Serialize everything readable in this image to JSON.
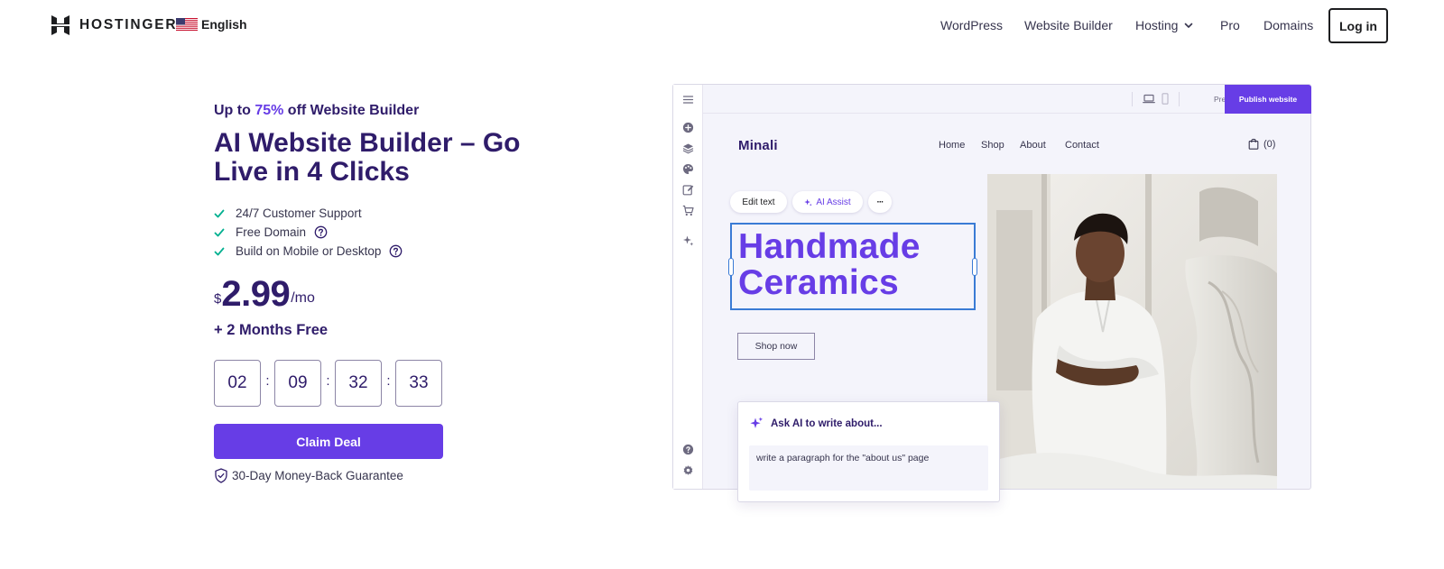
{
  "header": {
    "brand": "HOSTINGER",
    "language": "English",
    "nav": [
      {
        "label": "WordPress"
      },
      {
        "label": "Website Builder"
      },
      {
        "label": "Hosting"
      },
      {
        "label": "Pro"
      },
      {
        "label": "Domains"
      }
    ],
    "login_label": "Log in",
    "icons": {
      "logo": "hostinger-logo-icon",
      "flag": "us-flag-icon",
      "dropdown": "chevron-down-icon"
    }
  },
  "hero": {
    "promo_prefix": "Up to ",
    "promo_accent": "75%",
    "promo_suffix": " off Website Builder",
    "title": "AI Website Builder – Go Live in 4 Clicks",
    "features": [
      {
        "label": "24/7 Customer Support",
        "has_help": false
      },
      {
        "label": "Free Domain",
        "has_help": true
      },
      {
        "label": "Build on Mobile or Desktop",
        "has_help": true
      }
    ],
    "price": {
      "currency": "$",
      "amount": "2.99",
      "period": "/mo"
    },
    "bonus": "+ 2 Months Free",
    "countdown": {
      "values": [
        "02",
        "09",
        "32",
        "33"
      ],
      "separator": ":"
    },
    "cta_label": "Claim Deal",
    "guarantee": "30-Day Money-Back Guarantee"
  },
  "builder": {
    "toolbar": {
      "preview_label": "Preview",
      "publish_label": "Publish website"
    },
    "site": {
      "logo": "Minali",
      "nav": [
        "Home",
        "Shop",
        "About",
        "Contact"
      ],
      "cart_label": "(0)",
      "edit_text_label": "Edit text",
      "ai_assist_label": "AI Assist",
      "more_label": "···",
      "headline": "Handmade Ceramics",
      "shop_button": "Shop now"
    },
    "ai_panel": {
      "title": "Ask AI to write about...",
      "prompt": "write a paragraph for the \"about us\" page"
    }
  },
  "colors": {
    "accent": "#673de6",
    "brand_dark": "#2f1c6a",
    "check_green": "#00b090",
    "selection_blue": "#3a7bd5"
  }
}
